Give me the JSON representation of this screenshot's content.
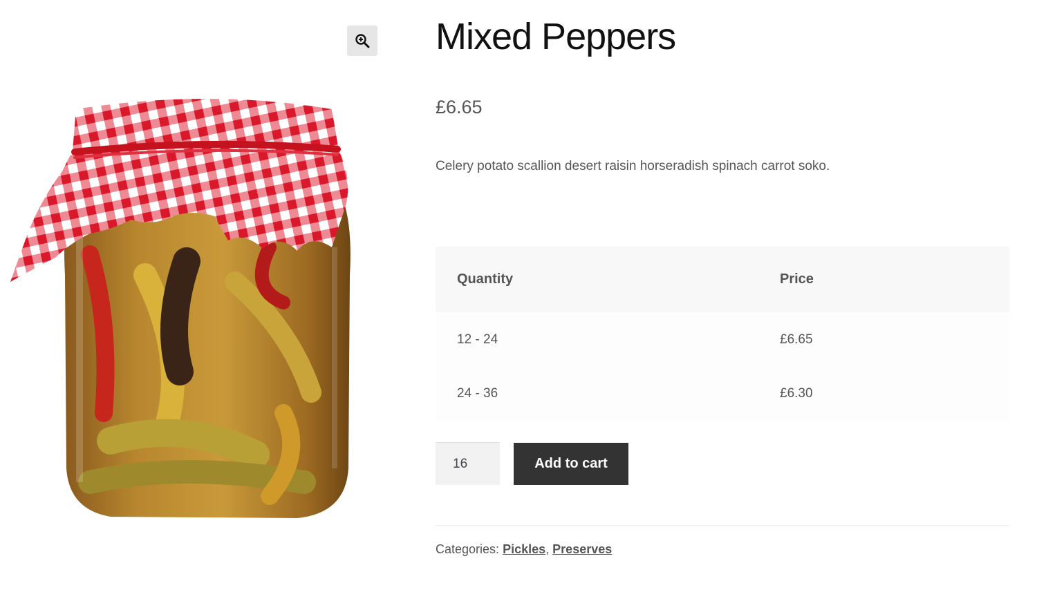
{
  "gallery": {
    "zoom_icon": "zoom-in-magnifier-icon",
    "image_alt": "Jar of mixed pickled peppers with red gingham cloth lid"
  },
  "product": {
    "title": "Mixed Peppers",
    "price": "£6.65",
    "description": "Celery potato scallion desert raisin horseradish spinach carrot soko."
  },
  "pricing_table": {
    "headers": [
      "Quantity",
      "Price"
    ],
    "rows": [
      {
        "quantity": "12 - 24",
        "price": "£6.65"
      },
      {
        "quantity": "24 - 36",
        "price": "£6.30"
      }
    ]
  },
  "cart": {
    "quantity_value": "16",
    "add_to_cart_label": "Add to cart"
  },
  "meta": {
    "categories_label": "Categories:",
    "categories": [
      "Pickles",
      "Preserves"
    ],
    "separator": ","
  },
  "colors": {
    "button_bg": "#333333",
    "checkered_red": "#d9182b",
    "table_header_bg": "#f8f8f8"
  }
}
